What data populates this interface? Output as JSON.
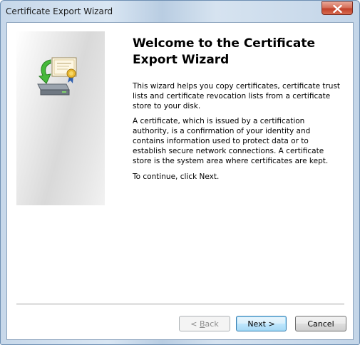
{
  "window": {
    "title": "Certificate Export Wizard"
  },
  "page": {
    "heading": "Welcome to the Certificate Export Wizard",
    "paragraph_1": "This wizard helps you copy certificates, certificate trust lists and certificate revocation lists from a certificate store to your disk.",
    "paragraph_2": "A certificate, which is issued by a certification authority, is a confirmation of your identity and contains information used to protect data or to establish secure network connections. A certificate store is the system area where certificates are kept.",
    "paragraph_3": "To continue, click Next."
  },
  "buttons": {
    "back_prefix": "< ",
    "back_underlined": "B",
    "back_rest": "ack",
    "next_label": "Next >",
    "cancel_label": "Cancel"
  },
  "icons": {
    "close": "close-icon",
    "wizard": "certificate-export-icon"
  },
  "colors": {
    "close_button": "#c9452d",
    "default_button_border": "#3c7fb1"
  }
}
